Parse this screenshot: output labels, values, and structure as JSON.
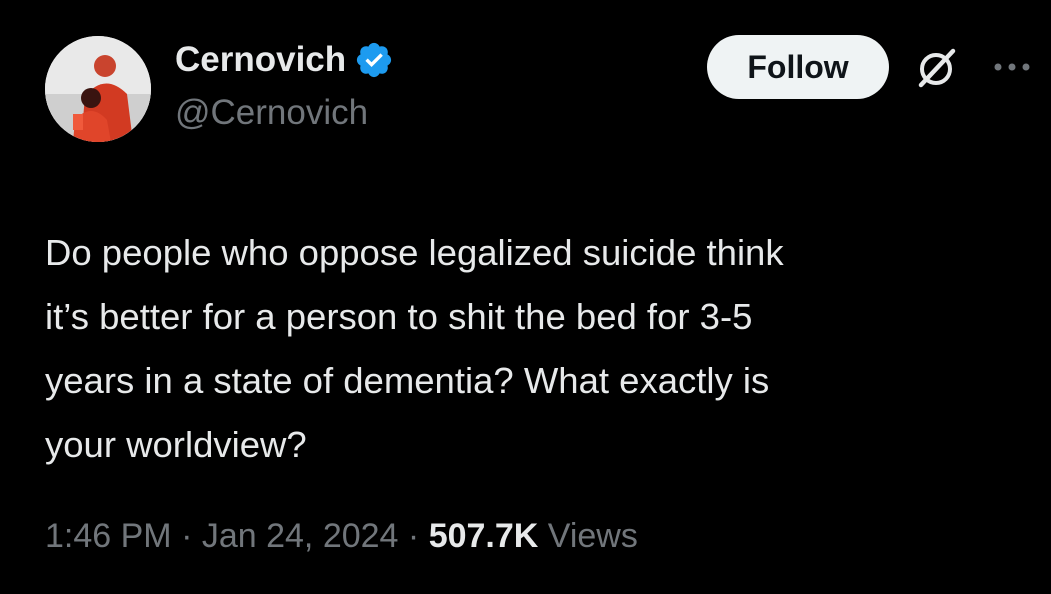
{
  "author": {
    "display_name": "Cernovich",
    "handle": "@Cernovich",
    "verified": true
  },
  "follow_label": "Follow",
  "tweet": {
    "text": "Do people who oppose legalized suicide think\nit’s better for a person to shit the bed for 3-5\nyears in a state of dementia? What exactly is\nyour worldview?"
  },
  "meta": {
    "time": "1:46 PM",
    "separator": " · ",
    "date": "Jan 24, 2024",
    "views_count": "507.7K",
    "views_label": " Views"
  },
  "colors": {
    "background": "#000000",
    "text": "#e7e9ea",
    "secondary": "#71767b",
    "verified": "#1d9bf0",
    "follow_bg": "#eff3f4"
  },
  "icons": [
    "verified-badge-icon",
    "grok-icon",
    "more-options-icon"
  ]
}
